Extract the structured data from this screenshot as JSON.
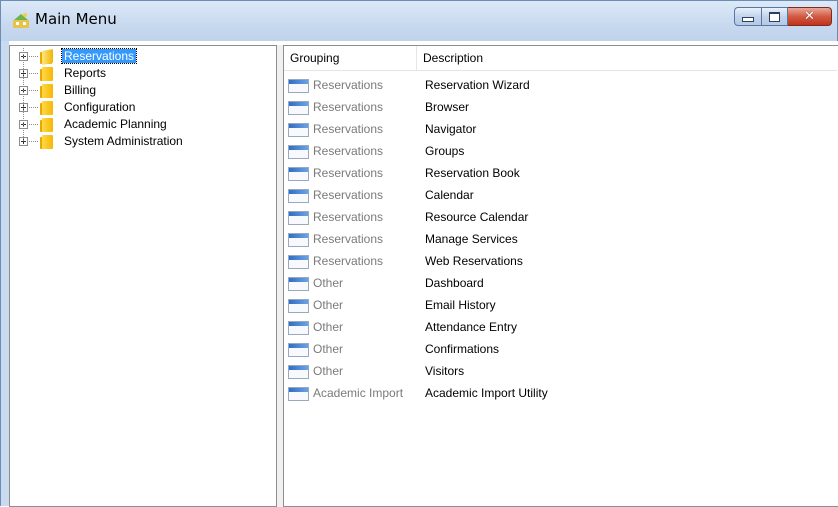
{
  "window": {
    "title": "Main Menu",
    "minimize_icon": "minimize-icon",
    "maximize_icon": "maximize-icon",
    "close_icon": "close-icon"
  },
  "tree": {
    "items": [
      {
        "label": "Reservations",
        "selected": true
      },
      {
        "label": "Reports"
      },
      {
        "label": "Billing"
      },
      {
        "label": "Configuration"
      },
      {
        "label": "Academic Planning"
      },
      {
        "label": "System Administration"
      }
    ]
  },
  "list": {
    "columns": {
      "grouping": "Grouping",
      "description": "Description"
    },
    "rows": [
      {
        "grouping": "Reservations",
        "description": "Reservation Wizard"
      },
      {
        "grouping": "Reservations",
        "description": "Browser"
      },
      {
        "grouping": "Reservations",
        "description": "Navigator"
      },
      {
        "grouping": "Reservations",
        "description": "Groups"
      },
      {
        "grouping": "Reservations",
        "description": "Reservation Book"
      },
      {
        "grouping": "Reservations",
        "description": "Calendar"
      },
      {
        "grouping": "Reservations",
        "description": "Resource Calendar"
      },
      {
        "grouping": "Reservations",
        "description": "Manage Services"
      },
      {
        "grouping": "Reservations",
        "description": "Web Reservations"
      },
      {
        "grouping": "Other",
        "description": "Dashboard"
      },
      {
        "grouping": "Other",
        "description": "Email History"
      },
      {
        "grouping": "Other",
        "description": "Attendance Entry"
      },
      {
        "grouping": "Other",
        "description": "Confirmations"
      },
      {
        "grouping": "Other",
        "description": "Visitors"
      },
      {
        "grouping": "Academic Import",
        "description": "Academic Import Utility"
      }
    ]
  },
  "colors": {
    "selection": "#3399ff",
    "grouping_text": "#7a7a7a",
    "title_bar": "#c8d9ef",
    "close_button": "#c2331a"
  }
}
